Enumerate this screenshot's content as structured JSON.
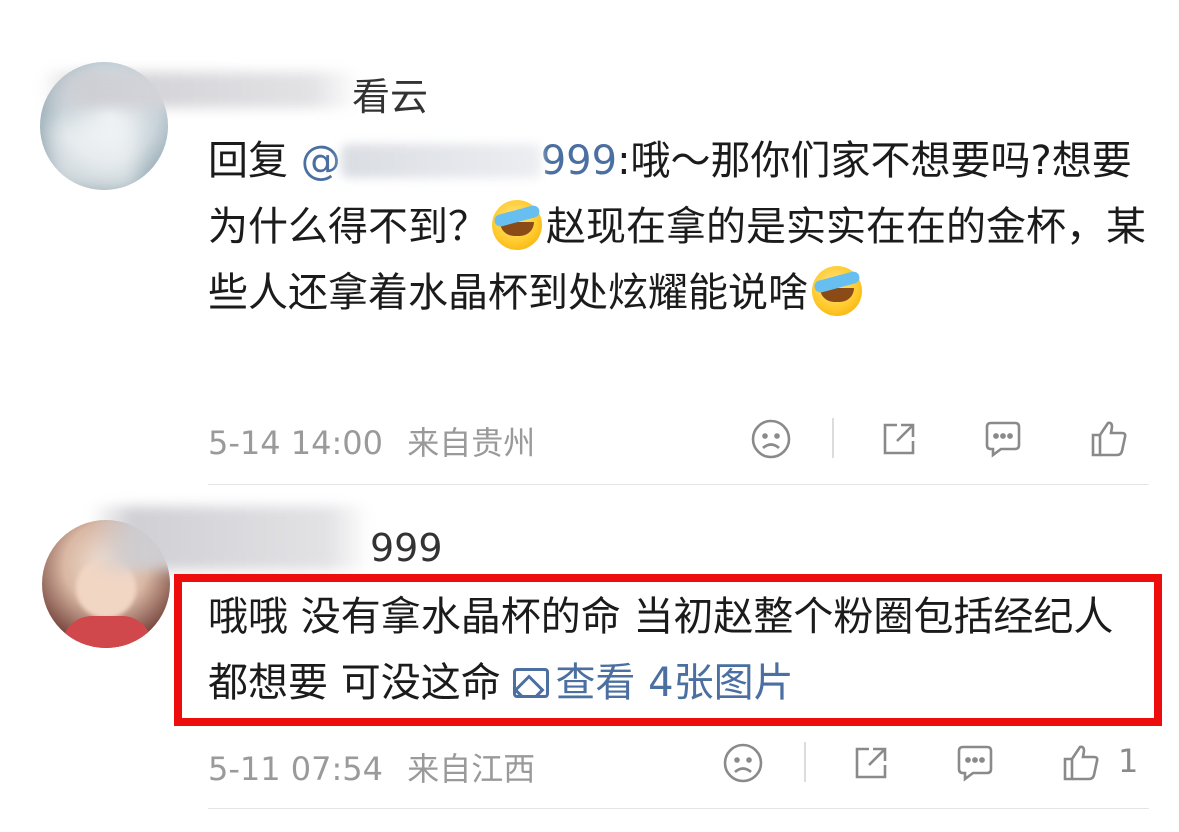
{
  "comments": [
    {
      "username_visible": "看云",
      "reply_prefix": "回复 ",
      "mention_visible": "@",
      "mention_tail": "999",
      "text_part1": ":哦～那你们家不想要吗?想要为什么得不到？",
      "text_part2": "赵现在拿的是实实在在的金杯，某些人还拿着水晶杯到处炫耀能说啥",
      "emoji_name": "facepalm-laugh-emoji",
      "date": "5-14 14:00",
      "location": "来自贵州",
      "like_count": ""
    },
    {
      "username_visible": "999",
      "text": "哦哦  没有拿水晶杯的命  当初赵整个粉圈包括经纪人都想要 可没这命 ",
      "pictures_link": "查看 4张图片",
      "date": "5-11 07:54",
      "location": "来自江西",
      "like_count": "1"
    }
  ],
  "icons": {
    "dislike": "sad-face-icon",
    "share": "share-icon",
    "comment": "comment-bubble-icon",
    "like": "thumbs-up-icon",
    "pictures": "image-icon"
  },
  "colors": {
    "highlight_border": "#ee0d0d",
    "link": "#4a6fa0",
    "meta": "#9a9a9a"
  }
}
